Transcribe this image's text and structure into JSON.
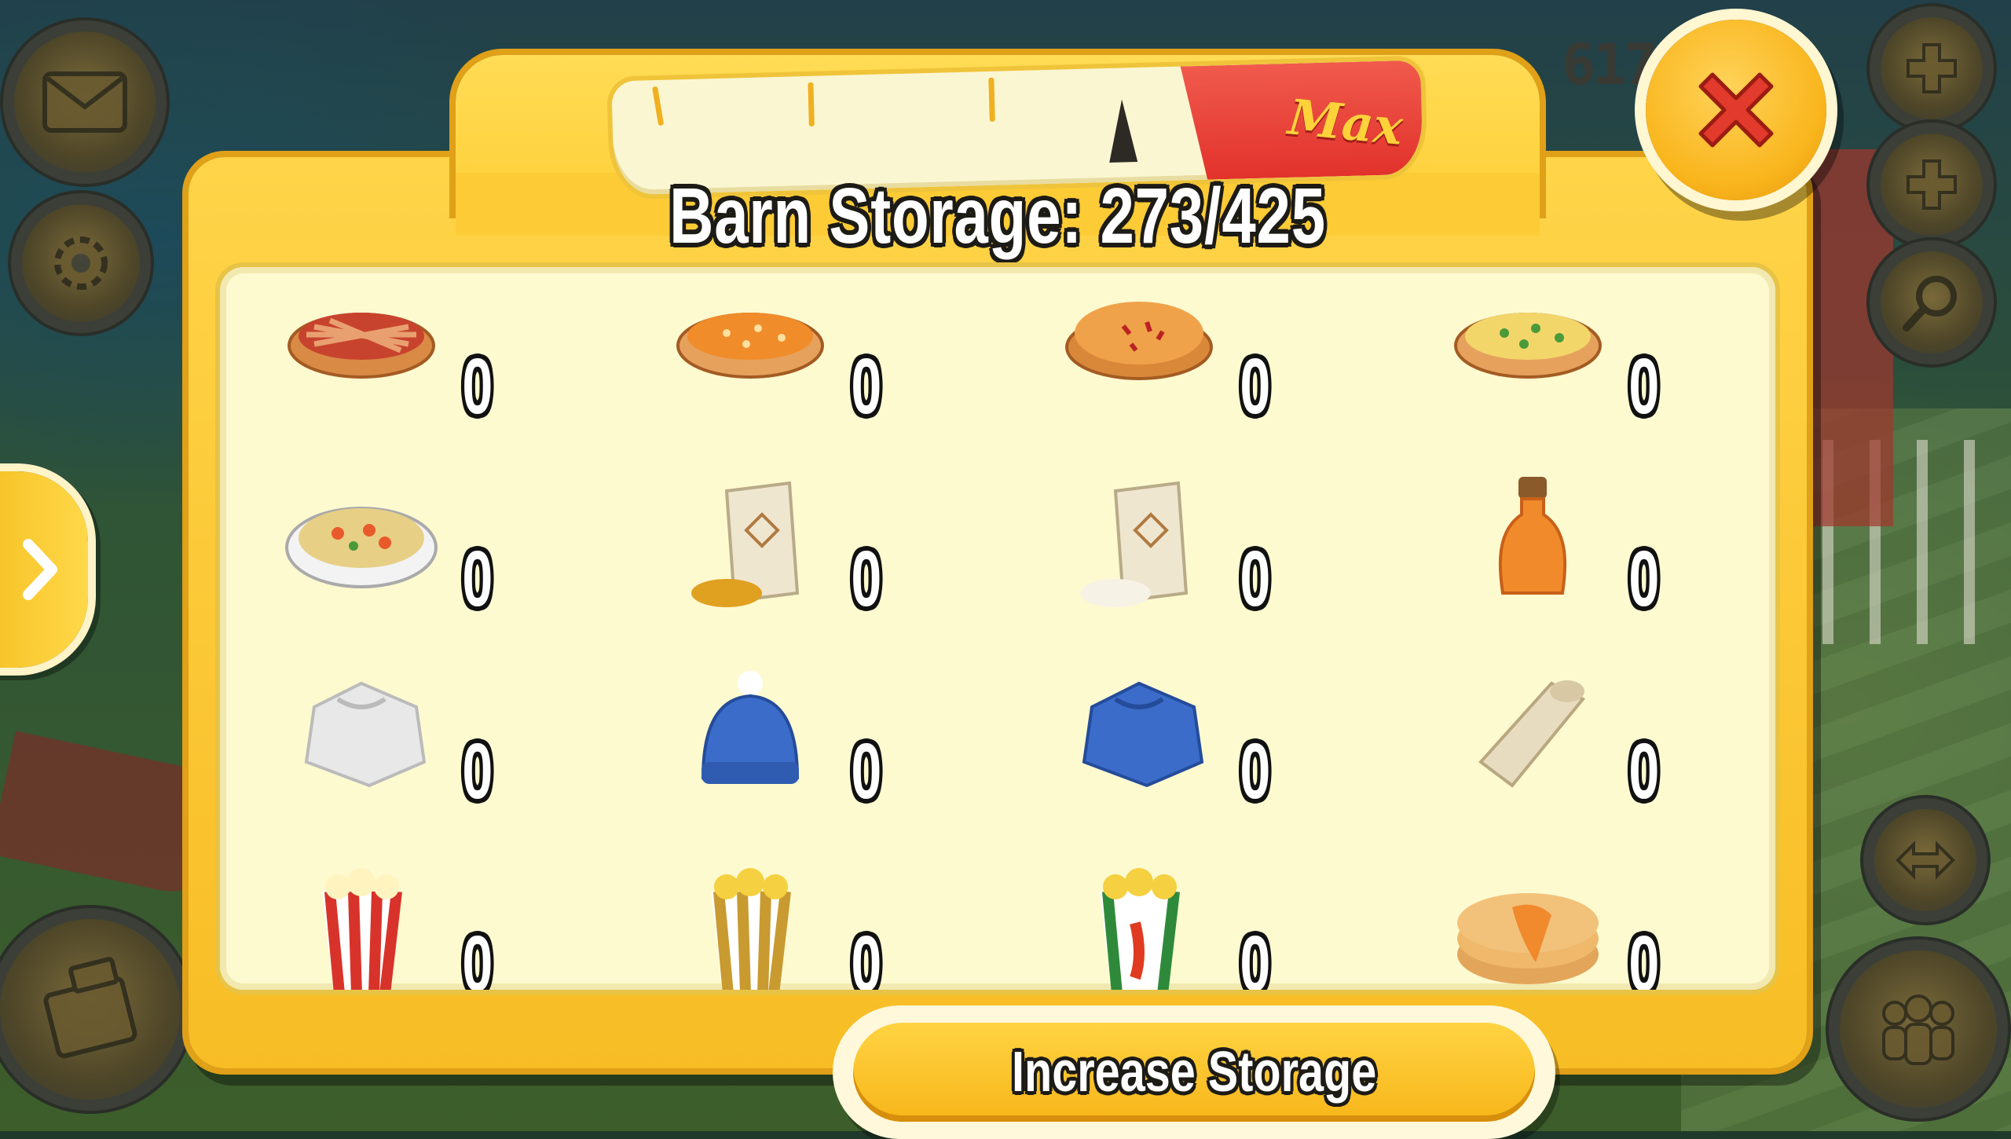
{
  "dialog": {
    "title": "Barn Storage: 273/425",
    "meter": {
      "level": 0.642,
      "max_label": "Max"
    },
    "increase_button": "Increase Storage"
  },
  "hud": {
    "counter": "617"
  },
  "items": [
    {
      "name": "bacon-pie",
      "icon": "bacon-pie-icon",
      "qty": "0"
    },
    {
      "name": "pumpkin-pie",
      "icon": "pumpkin-pie-icon",
      "qty": "0"
    },
    {
      "name": "apple-pie",
      "icon": "apple-pie-icon",
      "qty": "0"
    },
    {
      "name": "quiche",
      "icon": "quiche-icon",
      "qty": "0"
    },
    {
      "name": "casserole",
      "icon": "casserole-icon",
      "qty": "0"
    },
    {
      "name": "corn-flour",
      "icon": "corn-flour-sack-icon",
      "qty": "0"
    },
    {
      "name": "wheat-flour",
      "icon": "wheat-flour-sack-icon",
      "qty": "0"
    },
    {
      "name": "syrup",
      "icon": "syrup-bottle-icon",
      "qty": "0"
    },
    {
      "name": "white-sweater",
      "icon": "white-sweater-icon",
      "qty": "0"
    },
    {
      "name": "blue-woolly-hat",
      "icon": "blue-woolly-hat-icon",
      "qty": "0"
    },
    {
      "name": "blue-sweater",
      "icon": "blue-sweater-icon",
      "qty": "0"
    },
    {
      "name": "cotton-fabric",
      "icon": "fabric-roll-icon",
      "qty": "0"
    },
    {
      "name": "popcorn",
      "icon": "popcorn-red-icon",
      "qty": "0"
    },
    {
      "name": "buttered-popcorn",
      "icon": "popcorn-yellow-icon",
      "qty": "0"
    },
    {
      "name": "chili-popcorn",
      "icon": "popcorn-chili-icon",
      "qty": "0"
    },
    {
      "name": "pancakes",
      "icon": "pancakes-icon",
      "qty": "0"
    }
  ]
}
